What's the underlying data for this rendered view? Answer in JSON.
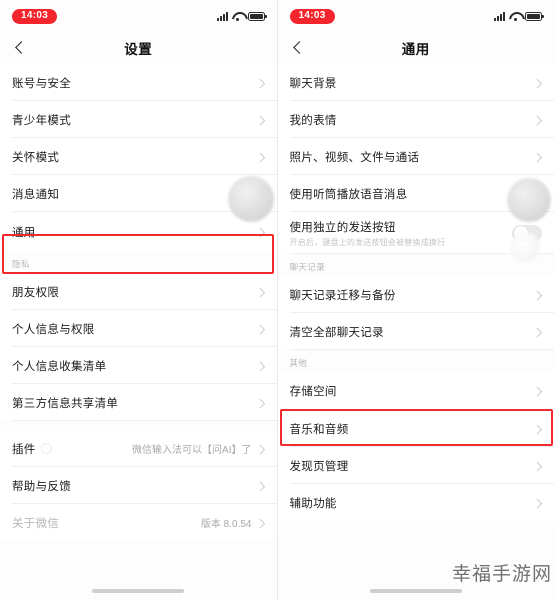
{
  "colors": {
    "accent_red": "#f5252d",
    "highlight_box": "#f2292f",
    "toggle_on_green": "#07c160",
    "text_primary": "#1c1c1c",
    "text_muted": "#b5b5b5",
    "chevron": "#c9c9c9"
  },
  "left_screen": {
    "status_bar": {
      "time": "14:03",
      "signal_icon": "signal-bars-icon",
      "wifi_icon": "wifi-icon",
      "battery_icon": "battery-icon"
    },
    "nav": {
      "back_icon": "back-chevron-icon",
      "title": "设置"
    },
    "rows": [
      {
        "label": "账号与安全",
        "chevron": true
      },
      {
        "label": "青少年模式",
        "chevron": true
      },
      {
        "label": "关怀模式",
        "chevron": true
      },
      {
        "label": "消息通知",
        "chevron": true
      },
      {
        "label": "通用",
        "chevron": true,
        "highlighted": true
      }
    ],
    "privacy_group_label": "隐私",
    "privacy_rows": [
      {
        "label": "朋友权限",
        "chevron": true
      },
      {
        "label": "个人信息与权限",
        "chevron": true
      },
      {
        "label": "个人信息收集清单",
        "chevron": true
      },
      {
        "label": "第三方信息共享清单",
        "chevron": true
      }
    ],
    "bottom_rows": [
      {
        "label": "插件",
        "badge": true,
        "value": "微信输入法可以【问AI】了",
        "chevron": true
      },
      {
        "label": "帮助与反馈",
        "chevron": true
      },
      {
        "label": "关于微信",
        "muted": true,
        "value": "版本 8.0.54",
        "chevron": true
      }
    ]
  },
  "right_screen": {
    "status_bar": {
      "time": "14:03",
      "signal_icon": "signal-bars-icon",
      "wifi_icon": "wifi-icon",
      "battery_icon": "battery-icon"
    },
    "nav": {
      "back_icon": "back-chevron-icon",
      "title": "通用"
    },
    "rows": [
      {
        "label": "聊天背景",
        "chevron": true
      },
      {
        "label": "我的表情",
        "chevron": true
      },
      {
        "label": "照片、视频、文件与通话",
        "chevron": true
      },
      {
        "label": "使用听筒播放语音消息",
        "toggle": "off"
      },
      {
        "label": "使用独立的发送按钮",
        "sub": "开启后，键盘上的发送按钮会被替换成换行",
        "toggle": "off"
      }
    ],
    "chat_group_label": "聊天记录",
    "chat_rows": [
      {
        "label": "聊天记录迁移与备份",
        "chevron": true
      },
      {
        "label": "清空全部聊天记录",
        "chevron": true
      }
    ],
    "other_group_label": "其他",
    "other_rows": [
      {
        "label": "存储空间",
        "chevron": true,
        "highlighted": true
      },
      {
        "label": "音乐和音频",
        "chevron": true
      },
      {
        "label": "发现页管理",
        "chevron": true
      },
      {
        "label": "辅助功能",
        "chevron": true
      }
    ]
  },
  "watermark": {
    "text": "幸福手游网"
  }
}
